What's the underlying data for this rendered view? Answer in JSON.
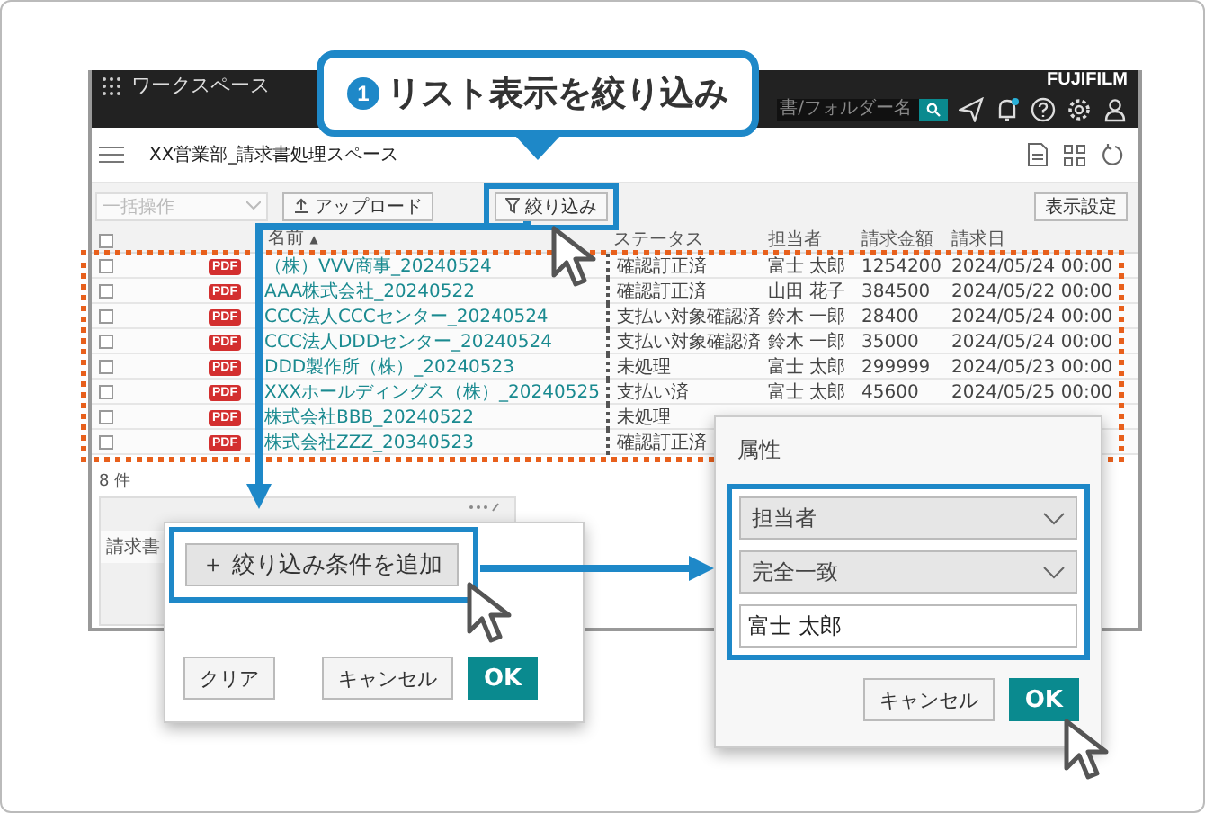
{
  "callout": {
    "number": "1",
    "text": "リスト表示を絞り込み"
  },
  "app": {
    "title": "ワークスペース",
    "search_placeholder": "書/フォルダー名",
    "logo": "FUJIFILM",
    "notification_dot": true
  },
  "workspace": {
    "title": "XX営業部_請求書処理スペース"
  },
  "toolbar": {
    "bulk_placeholder": "一括操作",
    "upload": "アップロード",
    "filter": "絞り込み",
    "view_settings": "表示設定"
  },
  "table": {
    "select_all_checked": false,
    "sort_mark": "▲",
    "columns": [
      "名前",
      "ステータス",
      "担当者",
      "請求金額",
      "請求日"
    ],
    "rows": [
      {
        "checked": false,
        "file_type": "PDF",
        "name": "（株）VVV商事_20240524",
        "status": "確認訂正済",
        "person": "富士 太郎",
        "amount": "1254200",
        "date": "2024/05/24 00:00"
      },
      {
        "checked": false,
        "file_type": "PDF",
        "name": "AAA株式会社_20240522",
        "status": "確認訂正済",
        "person": "山田 花子",
        "amount": "384500",
        "date": "2024/05/22 00:00"
      },
      {
        "checked": false,
        "file_type": "PDF",
        "name": "CCC法人CCCセンター_20240524",
        "status": "支払い対象確認済",
        "person": "鈴木 一郎",
        "amount": "28400",
        "date": "2024/05/24 00:00"
      },
      {
        "checked": false,
        "file_type": "PDF",
        "name": "CCC法人DDDセンター_20240524",
        "status": "支払い対象確認済",
        "person": "鈴木 一郎",
        "amount": "35000",
        "date": "2024/05/24 00:00"
      },
      {
        "checked": false,
        "file_type": "PDF",
        "name": "DDD製作所（株）_20240523",
        "status": "未処理",
        "person": "富士 太郎",
        "amount": "299999",
        "date": "2024/05/23 00:00"
      },
      {
        "checked": false,
        "file_type": "PDF",
        "name": "XXXホールディングス（株）_20240525",
        "status": "支払い済",
        "person": "富士 太郎",
        "amount": "45600",
        "date": "2024/05/25 00:00"
      },
      {
        "checked": false,
        "file_type": "PDF",
        "name": "株式会社BBB_20240522",
        "status": "未処理"
      },
      {
        "checked": false,
        "file_type": "PDF",
        "name": "株式会社ZZZ_20340523",
        "status": "確認訂正済"
      }
    ],
    "count": "8 件"
  },
  "back_panel": {
    "tab": "請求書"
  },
  "filter_dialog": {
    "add_condition": "＋ 絞り込み条件を追加",
    "buttons": [
      {
        "label": "クリア",
        "kind": "plain"
      },
      {
        "label": "キャンセル",
        "kind": "plain"
      },
      {
        "label": "OK",
        "kind": "primary"
      }
    ]
  },
  "attribute_dialog": {
    "title": "属性",
    "attribute": "担当者",
    "match": "完全一致",
    "value": "富士 太郎",
    "buttons": [
      {
        "label": "キャンセル",
        "kind": "plain"
      },
      {
        "label": "OK",
        "kind": "primary"
      }
    ]
  }
}
